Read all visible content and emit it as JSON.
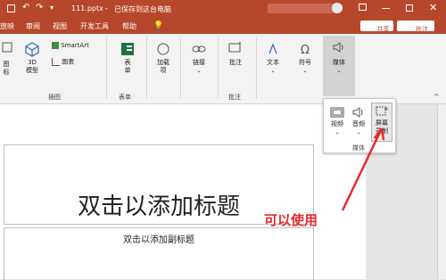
{
  "title": {
    "file": "111.pptx",
    "separator": "-",
    "status": "已保存到这台电脑"
  },
  "tabs": [
    "放映",
    "审阅",
    "视图",
    "开发工具",
    "帮助"
  ],
  "tell_me_icon": "lightbulb-icon",
  "share": {
    "label": "共享"
  },
  "comments": {
    "label": "批注"
  },
  "ribbon": {
    "groups": {
      "illustrations": {
        "label": "插图",
        "buttons": {
          "icons": "图标",
          "models_3d_line1": "3D",
          "models_3d_line2": "模型",
          "smartart": "SmartArt",
          "chart": "图表"
        }
      },
      "forms": {
        "label": "表单",
        "form_line1": "表",
        "form_line2": "单"
      },
      "addins": {
        "label1": "加载",
        "label2": "项"
      },
      "links": {
        "label": "链接"
      },
      "comments_grp": {
        "label": "批注",
        "button": "批注"
      },
      "text": {
        "label": "文本"
      },
      "symbols": {
        "label": "符号"
      },
      "media": {
        "label": "媒体"
      }
    },
    "left_partial": {
      "a": "图",
      "b": "标"
    }
  },
  "media_popup": {
    "video": "视频",
    "audio": "音频",
    "screen_record_line1": "屏幕",
    "screen_record_line2": "录制",
    "group_label": "媒体"
  },
  "slide": {
    "title_placeholder": "双击以添加标题",
    "subtitle_placeholder": "双击以添加副标题"
  },
  "annotation": {
    "text": "可以使用",
    "color": "#e8292c"
  },
  "colors": {
    "accent": "#b7472a",
    "annotation": "#e8292c"
  }
}
